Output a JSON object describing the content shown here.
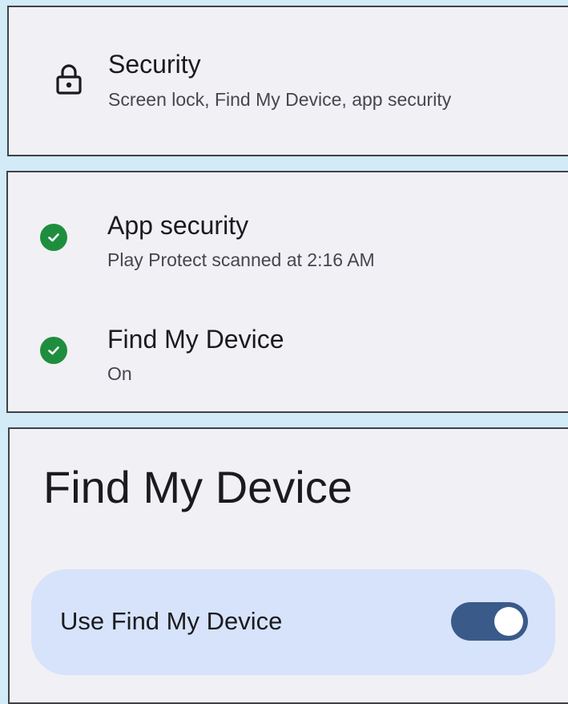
{
  "security": {
    "title": "Security",
    "subtitle": "Screen lock, Find My Device, app security",
    "icon": "lock-icon"
  },
  "status_items": [
    {
      "title": "App security",
      "subtitle": "Play Protect scanned at 2:16 AM",
      "icon": "check-circle-icon",
      "status_color": "#1e8e3e"
    },
    {
      "title": "Find My Device",
      "subtitle": "On",
      "icon": "check-circle-icon",
      "status_color": "#1e8e3e"
    }
  ],
  "find_my_device": {
    "heading": "Find My Device",
    "toggle_label": "Use Find My Device",
    "toggle_on": true,
    "toggle_color": "#3a5a8a"
  },
  "colors": {
    "background": "#d3eaf7",
    "card": "#f1f0f5",
    "toggle_row": "#d7e3fb"
  }
}
